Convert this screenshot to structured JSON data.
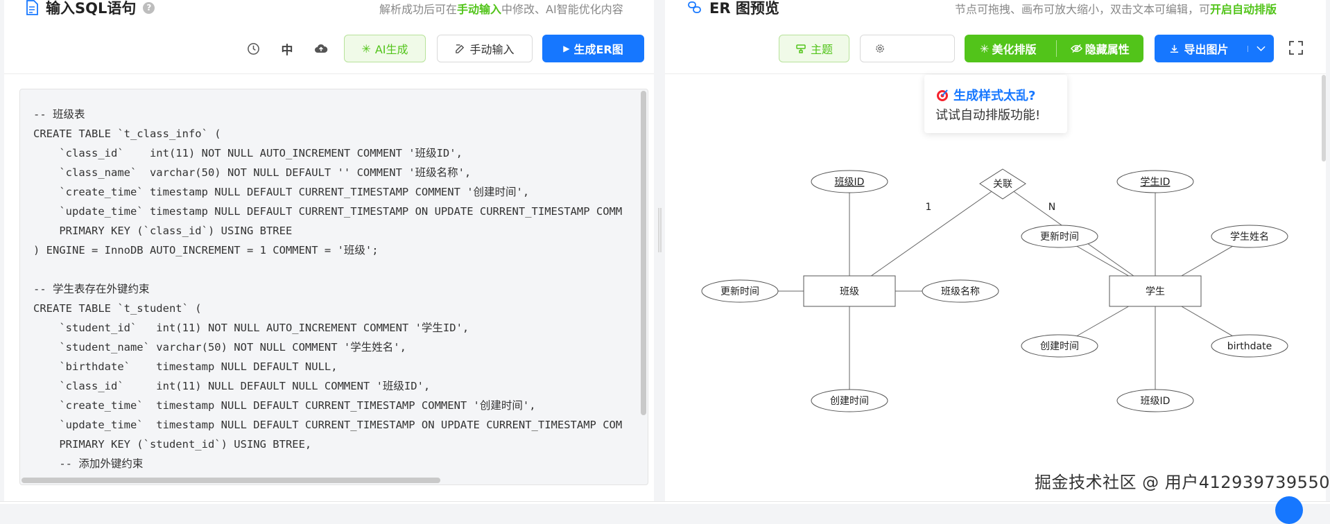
{
  "left": {
    "title": "输入SQL语句",
    "hint_prefix": "解析成功后可在",
    "hint_link": "手动输入",
    "hint_suffix": "中修改、AI智能优化内容",
    "lang_label": "中",
    "ai_button": "AI生成",
    "manual_button": "手动输入",
    "generate_button": "生成ER图",
    "code_lines": [
      "-- 班级表",
      "CREATE TABLE `t_class_info` (",
      "    `class_id`    int(11) NOT NULL AUTO_INCREMENT COMMENT '班级ID',",
      "    `class_name`  varchar(50) NOT NULL DEFAULT '' COMMENT '班级名称',",
      "    `create_time` timestamp NULL DEFAULT CURRENT_TIMESTAMP COMMENT '创建时间',",
      "    `update_time` timestamp NULL DEFAULT CURRENT_TIMESTAMP ON UPDATE CURRENT_TIMESTAMP COMM",
      "    PRIMARY KEY (`class_id`) USING BTREE",
      ") ENGINE = InnoDB AUTO_INCREMENT = 1 COMMENT = '班级';",
      "",
      "-- 学生表存在外键约束",
      "CREATE TABLE `t_student` (",
      "    `student_id`   int(11) NOT NULL AUTO_INCREMENT COMMENT '学生ID',",
      "    `student_name` varchar(50) NOT NULL COMMENT '学生姓名',",
      "    `birthdate`    timestamp NULL DEFAULT NULL,",
      "    `class_id`     int(11) NULL DEFAULT NULL COMMENT '班级ID',",
      "    `create_time`  timestamp NULL DEFAULT CURRENT_TIMESTAMP COMMENT '创建时间',",
      "    `update_time`  timestamp NULL DEFAULT CURRENT_TIMESTAMP ON UPDATE CURRENT_TIMESTAMP COM",
      "    PRIMARY KEY (`student_id`) USING BTREE,",
      "    -- 添加外键约束"
    ]
  },
  "right": {
    "title": "ER 图预览",
    "hint_prefix": "节点可拖拽、画布可放大缩小，双击文本可编辑，可",
    "hint_link": "开启自动排版",
    "theme_button": "主题",
    "beautify_button": "美化排版",
    "hide_attr_button": "隐藏属性",
    "export_button": "导出图片",
    "tip_title": "生成样式太乱?",
    "tip_body": "试试自动排版功能!"
  },
  "er": {
    "entity_class": "班级",
    "entity_student": "学生",
    "relation": "关联",
    "card_left": "1",
    "card_right": "N",
    "class_attrs": {
      "id": "班级ID",
      "name": "班级名称",
      "update": "更新时间",
      "create": "创建时间"
    },
    "student_attrs": {
      "id": "学生ID",
      "name": "学生姓名",
      "update": "更新时间",
      "create": "创建时间",
      "birth": "birthdate",
      "class_id": "班级ID"
    }
  },
  "watermark": "掘金技术社区 @ 用户412939739550",
  "colors": {
    "green": "#52c41a",
    "blue": "#1677ff"
  }
}
